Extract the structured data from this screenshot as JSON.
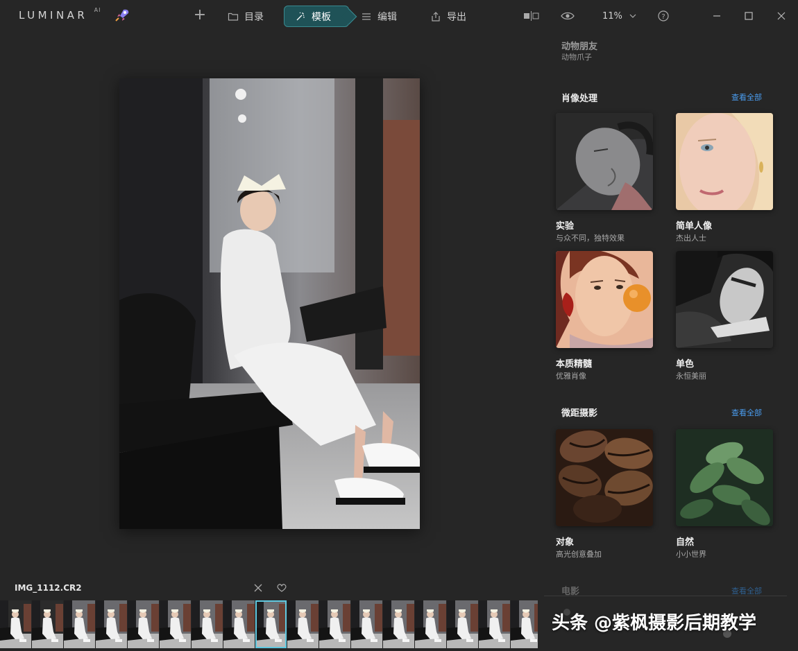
{
  "app": {
    "logo": "LUMINAR",
    "logo_suffix": "AI"
  },
  "nav": {
    "catalog": "目录",
    "templates": "模板",
    "edit": "编辑",
    "export": "导出",
    "zoom": "11%"
  },
  "file": {
    "name": "IMG_1112.CR2"
  },
  "panel": {
    "prev_section": {
      "title": "动物朋友",
      "subtitle": "动物爪子"
    },
    "sections": [
      {
        "title": "肖像处理",
        "see_all": "查看全部",
        "cards": [
          {
            "title": "实验",
            "subtitle": "与众不同，独特效果"
          },
          {
            "title": "简单人像",
            "subtitle": "杰出人士"
          },
          {
            "title": "本质精髓",
            "subtitle": "优雅肖像"
          },
          {
            "title": "单色",
            "subtitle": "永恒美丽"
          }
        ]
      },
      {
        "title": "微距摄影",
        "see_all": "查看全部",
        "cards": [
          {
            "title": "对象",
            "subtitle": "高光创意叠加"
          },
          {
            "title": "自然",
            "subtitle": "小小世界"
          }
        ]
      }
    ],
    "next_section": {
      "title": "电影",
      "see_all": "查看全部"
    }
  },
  "watermark": "头条 @紫枫摄影后期教学",
  "colors": {
    "accent": "#1f5257",
    "link": "#4a9df0",
    "selection": "#5fc8e0",
    "background": "#262626"
  }
}
